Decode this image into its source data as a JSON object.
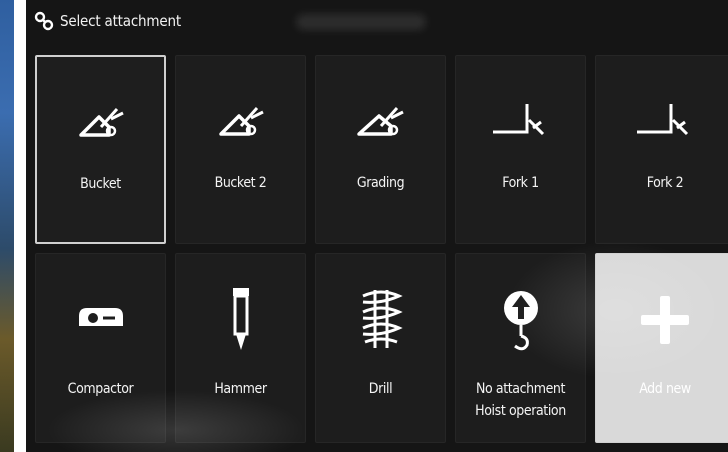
{
  "header": {
    "title": "Select attachment",
    "icon": "link-chain-icon"
  },
  "tiles": [
    {
      "label": "Bucket",
      "icon": "bucket-icon",
      "selected": true
    },
    {
      "label": "Bucket 2",
      "icon": "bucket-icon"
    },
    {
      "label": "Grading",
      "icon": "grading-bucket-icon"
    },
    {
      "label": "Fork 1",
      "icon": "fork-icon"
    },
    {
      "label": "Fork 2",
      "icon": "fork-icon"
    },
    {
      "label": "Compactor",
      "icon": "compactor-icon"
    },
    {
      "label": "Hammer",
      "icon": "hammer-icon"
    },
    {
      "label": "Drill",
      "icon": "drill-icon"
    },
    {
      "label": "No attachment",
      "sublabel": "Hoist operation",
      "icon": "hoist-hook-icon"
    },
    {
      "label": "Add new",
      "icon": "plus-icon"
    }
  ],
  "colors": {
    "background": "#151515",
    "tile": "#1d1d1d",
    "selected_border": "#cfcfcf",
    "add_new_tile": "#d9d9d9",
    "text": "#f4f4f4"
  }
}
